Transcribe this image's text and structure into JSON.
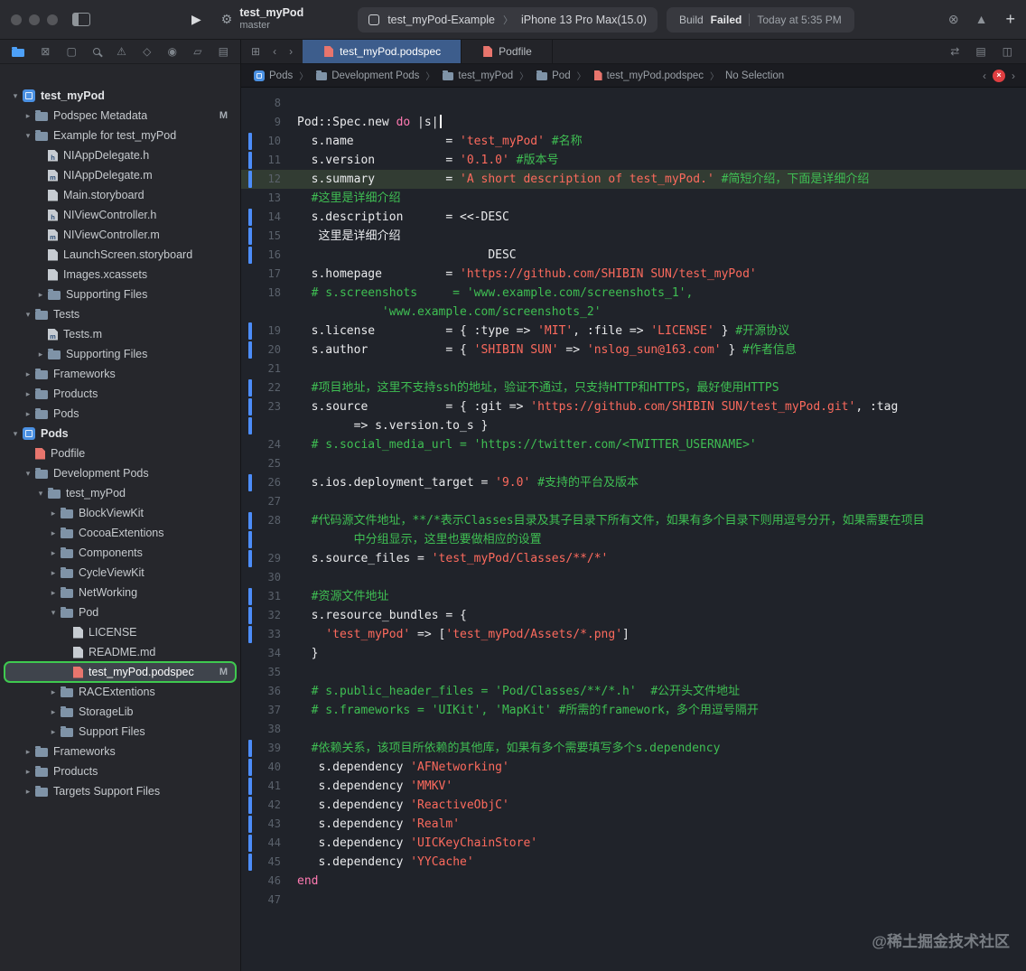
{
  "toolbar": {
    "project": "test_myPod",
    "branch": "master",
    "scheme": "test_myPod-Example",
    "device": "iPhone 13 Pro Max(15.0)",
    "status_build": "Build",
    "status_result": "Failed",
    "status_time": "Today at 5:35 PM",
    "run_glyph": "▶",
    "project_tool_glyph": "⚙",
    "scheme_chevron": "〉",
    "right_icons": [
      {
        "name": "clear-activity-icon",
        "glyph": "⊗"
      },
      {
        "name": "activity-warning-icon",
        "glyph": "▲"
      }
    ],
    "add_label": "+"
  },
  "tabbar": {
    "left_icons": [
      {
        "name": "tab-overview-icon",
        "glyph": "⊞"
      },
      {
        "name": "back-icon",
        "glyph": "‹"
      },
      {
        "name": "forward-icon",
        "glyph": "›"
      }
    ],
    "tabs": [
      {
        "label": "test_myPod.podspec",
        "active": true
      },
      {
        "label": "Podfile",
        "active": false
      }
    ],
    "right_icons": [
      {
        "name": "code-review-icon",
        "glyph": "⇄"
      },
      {
        "name": "editor-options-icon",
        "glyph": "▤"
      },
      {
        "name": "split-editor-icon",
        "glyph": "◫"
      }
    ]
  },
  "jumpbar": {
    "crumbs": [
      {
        "label": "Pods",
        "icon": "proj"
      },
      {
        "label": "Development Pods",
        "icon": "folder"
      },
      {
        "label": "test_myPod",
        "icon": "folder"
      },
      {
        "label": "Pod",
        "icon": "folder"
      },
      {
        "label": "test_myPod.podspec",
        "icon": "pod"
      },
      {
        "label": "No Selection",
        "icon": "none"
      }
    ],
    "back_glyph": "‹",
    "forward_glyph": "›",
    "error_glyph": "×"
  },
  "sidebar": {
    "navigators": [
      {
        "name": "project-navigator",
        "glyph": "folder",
        "selected": true
      },
      {
        "name": "source-control-navigator",
        "glyph": "⊠",
        "selected": false
      },
      {
        "name": "bookmark-navigator",
        "glyph": "▢",
        "selected": false
      },
      {
        "name": "find-navigator",
        "glyph": "mag",
        "selected": false
      },
      {
        "name": "issue-navigator",
        "glyph": "⚠",
        "selected": false
      },
      {
        "name": "test-navigator",
        "glyph": "◇",
        "selected": false
      },
      {
        "name": "debug-navigator",
        "glyph": "◉",
        "selected": false
      },
      {
        "name": "breakpoint-navigator",
        "glyph": "▱",
        "selected": false
      },
      {
        "name": "report-navigator",
        "glyph": "▤",
        "selected": false
      }
    ],
    "items": [
      {
        "label": "test_myPod",
        "level": 0,
        "icon": "project",
        "disc": "open"
      },
      {
        "label": "Podspec Metadata",
        "level": 1,
        "icon": "folder",
        "disc": "closed",
        "badge": "M"
      },
      {
        "label": "Example for test_myPod",
        "level": 1,
        "icon": "folder",
        "disc": "open"
      },
      {
        "label": "NIAppDelegate.h",
        "level": 2,
        "icon": "file-h",
        "disc": "none"
      },
      {
        "label": "NIAppDelegate.m",
        "level": 2,
        "icon": "file-m",
        "disc": "none"
      },
      {
        "label": "Main.storyboard",
        "level": 2,
        "icon": "storyboard",
        "disc": "none"
      },
      {
        "label": "NIViewController.h",
        "level": 2,
        "icon": "file-h",
        "disc": "none"
      },
      {
        "label": "NIViewController.m",
        "level": 2,
        "icon": "file-m",
        "disc": "none"
      },
      {
        "label": "LaunchScreen.storyboard",
        "level": 2,
        "icon": "storyboard",
        "disc": "none"
      },
      {
        "label": "Images.xcassets",
        "level": 2,
        "icon": "assets",
        "disc": "none"
      },
      {
        "label": "Supporting Files",
        "level": 2,
        "icon": "folder",
        "disc": "closed"
      },
      {
        "label": "Tests",
        "level": 1,
        "icon": "folder",
        "disc": "open"
      },
      {
        "label": "Tests.m",
        "level": 2,
        "icon": "file-m",
        "disc": "none"
      },
      {
        "label": "Supporting Files",
        "level": 2,
        "icon": "folder",
        "disc": "closed"
      },
      {
        "label": "Frameworks",
        "level": 1,
        "icon": "folder",
        "disc": "closed"
      },
      {
        "label": "Products",
        "level": 1,
        "icon": "folder",
        "disc": "closed"
      },
      {
        "label": "Pods",
        "level": 1,
        "icon": "folder",
        "disc": "closed"
      },
      {
        "label": "Pods",
        "level": 0,
        "icon": "project",
        "disc": "open"
      },
      {
        "label": "Podfile",
        "level": 1,
        "icon": "podfile",
        "disc": "none"
      },
      {
        "label": "Development Pods",
        "level": 1,
        "icon": "folder",
        "disc": "open"
      },
      {
        "label": "test_myPod",
        "level": 2,
        "icon": "folder",
        "disc": "open"
      },
      {
        "label": "BlockViewKit",
        "level": 3,
        "icon": "folder",
        "disc": "closed"
      },
      {
        "label": "CocoaExtentions",
        "level": 3,
        "icon": "folder",
        "disc": "closed"
      },
      {
        "label": "Components",
        "level": 3,
        "icon": "folder",
        "disc": "closed"
      },
      {
        "label": "CycleViewKit",
        "level": 3,
        "icon": "folder",
        "disc": "closed"
      },
      {
        "label": "NetWorking",
        "level": 3,
        "icon": "folder",
        "disc": "closed"
      },
      {
        "label": "Pod",
        "level": 3,
        "icon": "folder",
        "disc": "open"
      },
      {
        "label": "LICENSE",
        "level": 4,
        "icon": "doc",
        "disc": "none"
      },
      {
        "label": "README.md",
        "level": 4,
        "icon": "doc",
        "disc": "none"
      },
      {
        "label": "test_myPod.podspec",
        "level": 4,
        "icon": "podspec",
        "disc": "none",
        "badge": "M",
        "selected": true
      },
      {
        "label": "RACExtentions",
        "level": 3,
        "icon": "folder",
        "disc": "closed"
      },
      {
        "label": "StorageLib",
        "level": 3,
        "icon": "folder",
        "disc": "closed"
      },
      {
        "label": "Support Files",
        "level": 3,
        "icon": "folder",
        "disc": "closed"
      },
      {
        "label": "Frameworks",
        "level": 1,
        "icon": "folder",
        "disc": "closed"
      },
      {
        "label": "Products",
        "level": 1,
        "icon": "folder",
        "disc": "closed"
      },
      {
        "label": "Targets Support Files",
        "level": 1,
        "icon": "folder",
        "disc": "closed"
      }
    ]
  },
  "editor": {
    "rows": [
      {
        "n": "8",
        "seg": []
      },
      {
        "n": "9",
        "seg": [
          [
            "p",
            "Pod::Spec.new "
          ],
          [
            "k",
            "do"
          ],
          [
            "p",
            " |s|"
          ],
          [
            "cursor",
            ""
          ]
        ]
      },
      {
        "n": "10",
        "ch": true,
        "seg": [
          [
            "p",
            "  s.name             = "
          ],
          [
            "s",
            "'test_myPod'"
          ],
          [
            "p",
            " "
          ],
          [
            "c",
            "#名称"
          ]
        ]
      },
      {
        "n": "11",
        "ch": true,
        "seg": [
          [
            "p",
            "  s.version          = "
          ],
          [
            "s",
            "'0.1.0'"
          ],
          [
            "p",
            " "
          ],
          [
            "c",
            "#版本号"
          ]
        ]
      },
      {
        "n": "12",
        "ch": true,
        "cur": true,
        "seg": [
          [
            "p",
            "  s.summary          = "
          ],
          [
            "s",
            "'A short description of test_myPod.'"
          ],
          [
            "p",
            " "
          ],
          [
            "c",
            "#简短介绍，下面是详细介绍"
          ]
        ]
      },
      {
        "n": "13",
        "seg": [
          [
            "c",
            "  #这里是详细介绍"
          ]
        ]
      },
      {
        "n": "14",
        "ch": true,
        "seg": [
          [
            "p",
            "  s.description      = <<-DESC"
          ]
        ]
      },
      {
        "n": "15",
        "ch": true,
        "seg": [
          [
            "p",
            "   这里是详细介绍"
          ]
        ]
      },
      {
        "n": "16",
        "ch": true,
        "seg": [
          [
            "p",
            "                           DESC"
          ]
        ]
      },
      {
        "n": "17",
        "seg": [
          [
            "p",
            "  s.homepage         = "
          ],
          [
            "s",
            "'https://github.com/SHIBIN SUN/test_myPod'"
          ]
        ]
      },
      {
        "n": "18",
        "seg": [
          [
            "c",
            "  # s.screenshots     = 'www.example.com/screenshots_1',"
          ]
        ]
      },
      {
        "n": "",
        "seg": [
          [
            "c",
            "            'www.example.com/screenshots_2'"
          ]
        ]
      },
      {
        "n": "19",
        "ch": true,
        "seg": [
          [
            "p",
            "  s.license          = { :type => "
          ],
          [
            "s",
            "'MIT'"
          ],
          [
            "p",
            ", :file => "
          ],
          [
            "s",
            "'LICENSE'"
          ],
          [
            "p",
            " } "
          ],
          [
            "c",
            "#开源协议"
          ]
        ]
      },
      {
        "n": "20",
        "ch": true,
        "seg": [
          [
            "p",
            "  s.author           = { "
          ],
          [
            "s",
            "'SHIBIN SUN'"
          ],
          [
            "p",
            " => "
          ],
          [
            "s",
            "'nslog_sun@163.com'"
          ],
          [
            "p",
            " } "
          ],
          [
            "c",
            "#作者信息"
          ]
        ]
      },
      {
        "n": "21",
        "seg": []
      },
      {
        "n": "22",
        "ch": true,
        "seg": [
          [
            "c",
            "  #项目地址，这里不支持ssh的地址，验证不通过，只支持HTTP和HTTPS，最好使用HTTPS"
          ]
        ]
      },
      {
        "n": "23",
        "ch": true,
        "seg": [
          [
            "p",
            "  s.source           = { :git => "
          ],
          [
            "s",
            "'https://github.com/SHIBIN SUN/test_myPod.git'"
          ],
          [
            "p",
            ", :tag"
          ]
        ]
      },
      {
        "n": "",
        "ch": true,
        "seg": [
          [
            "p",
            "        => s.version.to_s }"
          ]
        ]
      },
      {
        "n": "24",
        "seg": [
          [
            "c",
            "  # s.social_media_url = 'https://twitter.com/<TWITTER_USERNAME>'"
          ]
        ]
      },
      {
        "n": "25",
        "seg": []
      },
      {
        "n": "26",
        "ch": true,
        "seg": [
          [
            "p",
            "  s.ios.deployment_target = "
          ],
          [
            "s",
            "'9.0'"
          ],
          [
            "p",
            " "
          ],
          [
            "c",
            "#支持的平台及版本"
          ]
        ]
      },
      {
        "n": "27",
        "seg": []
      },
      {
        "n": "28",
        "ch": true,
        "seg": [
          [
            "c",
            "  #代码源文件地址，**/*表示Classes目录及其子目录下所有文件，如果有多个目录下则用逗号分开，如果需要在项目"
          ]
        ]
      },
      {
        "n": "",
        "ch": true,
        "seg": [
          [
            "c",
            "        中分组显示，这里也要做相应的设置"
          ]
        ]
      },
      {
        "n": "29",
        "ch": true,
        "seg": [
          [
            "p",
            "  s.source_files = "
          ],
          [
            "s",
            "'test_myPod/Classes/**/*'"
          ]
        ]
      },
      {
        "n": "30",
        "seg": []
      },
      {
        "n": "31",
        "ch": true,
        "seg": [
          [
            "c",
            "  #资源文件地址"
          ]
        ]
      },
      {
        "n": "32",
        "ch": true,
        "seg": [
          [
            "p",
            "  s.resource_bundles = {"
          ]
        ]
      },
      {
        "n": "33",
        "ch": true,
        "seg": [
          [
            "p",
            "    "
          ],
          [
            "s",
            "'test_myPod'"
          ],
          [
            "p",
            " => ["
          ],
          [
            "s",
            "'test_myPod/Assets/*.png'"
          ],
          [
            "p",
            "]"
          ]
        ]
      },
      {
        "n": "34",
        "seg": [
          [
            "p",
            "  }"
          ]
        ]
      },
      {
        "n": "35",
        "seg": []
      },
      {
        "n": "36",
        "seg": [
          [
            "c",
            "  # s.public_header_files = 'Pod/Classes/**/*.h'  #公开头文件地址"
          ]
        ]
      },
      {
        "n": "37",
        "seg": [
          [
            "c",
            "  # s.frameworks = 'UIKit', 'MapKit' #所需的framework，多个用逗号隔开"
          ]
        ]
      },
      {
        "n": "38",
        "seg": []
      },
      {
        "n": "39",
        "ch": true,
        "seg": [
          [
            "c",
            "  #依赖关系，该项目所依赖的其他库，如果有多个需要填写多个s.dependency"
          ]
        ]
      },
      {
        "n": "40",
        "ch": true,
        "seg": [
          [
            "p",
            "   s.dependency "
          ],
          [
            "s",
            "'AFNetworking'"
          ]
        ]
      },
      {
        "n": "41",
        "ch": true,
        "seg": [
          [
            "p",
            "   s.dependency "
          ],
          [
            "s",
            "'MMKV'"
          ]
        ]
      },
      {
        "n": "42",
        "ch": true,
        "seg": [
          [
            "p",
            "   s.dependency "
          ],
          [
            "s",
            "'ReactiveObjC'"
          ]
        ]
      },
      {
        "n": "43",
        "ch": true,
        "seg": [
          [
            "p",
            "   s.dependency "
          ],
          [
            "s",
            "'Realm'"
          ]
        ]
      },
      {
        "n": "44",
        "ch": true,
        "seg": [
          [
            "p",
            "   s.dependency "
          ],
          [
            "s",
            "'UICKeyChainStore'"
          ]
        ]
      },
      {
        "n": "45",
        "ch": true,
        "seg": [
          [
            "p",
            "   s.dependency "
          ],
          [
            "s",
            "'YYCache'"
          ]
        ]
      },
      {
        "n": "46",
        "seg": [
          [
            "k",
            "end"
          ]
        ]
      },
      {
        "n": "47",
        "seg": []
      }
    ]
  },
  "watermark": "@稀土掘金技术社区",
  "colors": {
    "tab_active": "#3d5d8c",
    "string": "#fc6a5d",
    "comment": "#3fbf53",
    "keyword": "#ff7ab2",
    "change_bar": "#4c8dfa",
    "selection_outline": "#3fc94f",
    "error_badge": "#e03e41",
    "navigator_selected": "#4da0f8"
  }
}
